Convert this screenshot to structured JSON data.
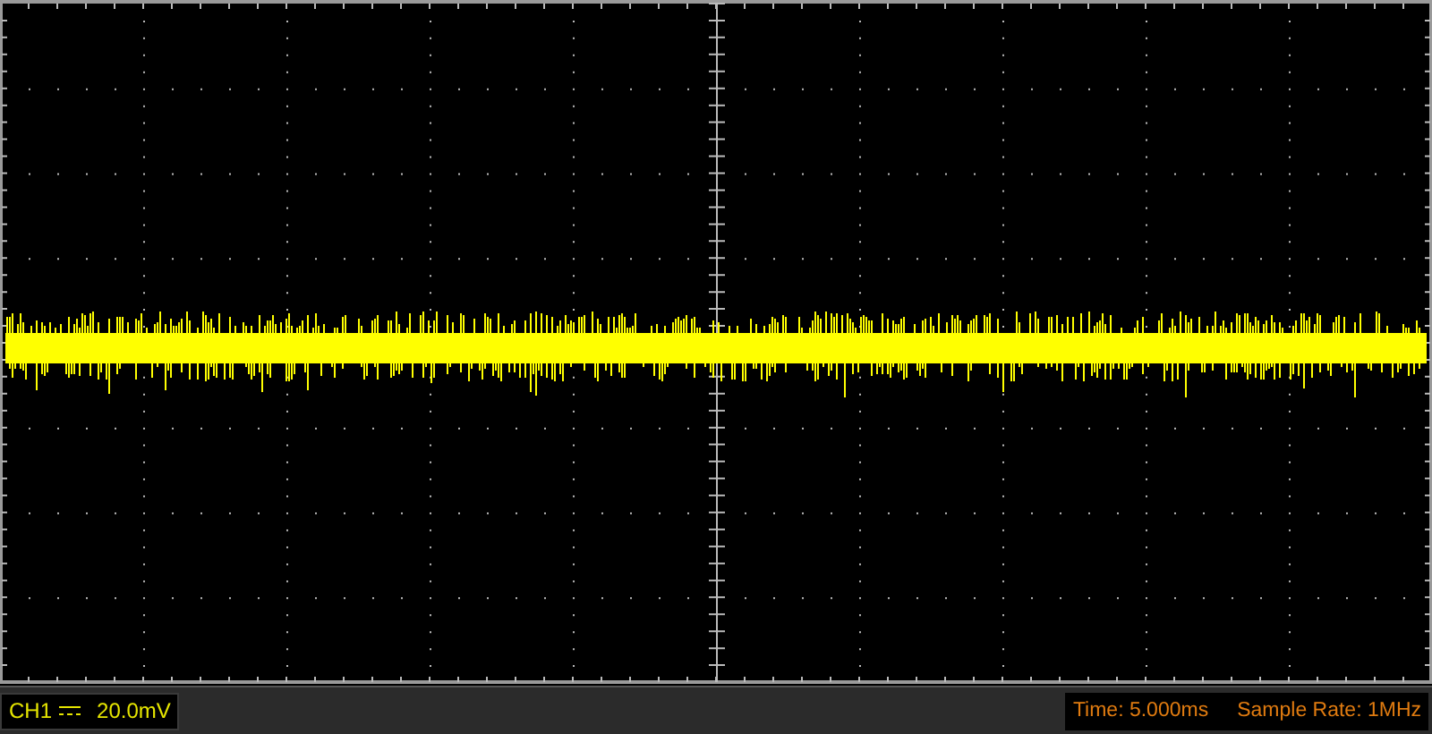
{
  "channel": {
    "name": "CH1",
    "scale": "20.0mV"
  },
  "acquisition": {
    "time": "Time: 5.000ms",
    "sample_rate": "Sample Rate: 1MHz"
  }
}
